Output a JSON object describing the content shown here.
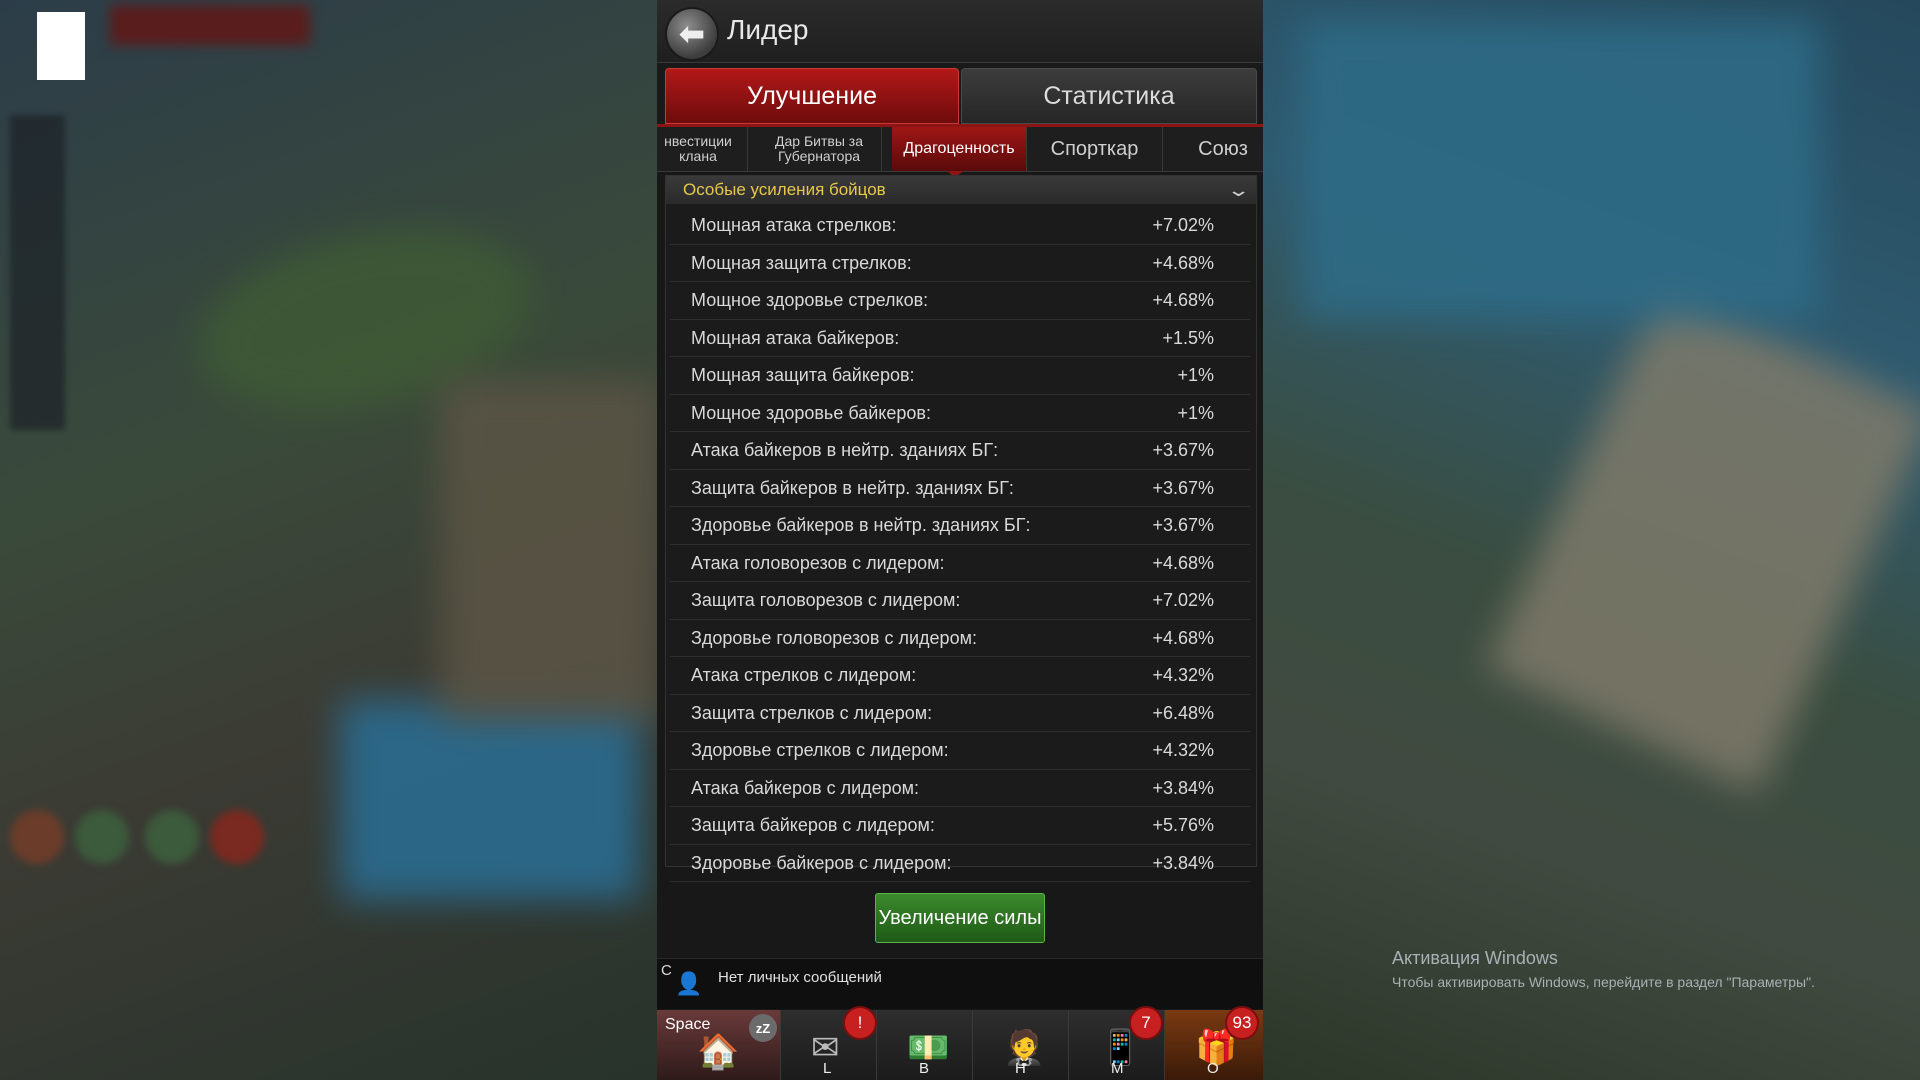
{
  "header": {
    "title": "Лидер"
  },
  "main_tabs": [
    {
      "label": "Улучшение",
      "active": true
    },
    {
      "label": "Статистика",
      "active": false
    }
  ],
  "sub_tabs": [
    {
      "label": "нвестиции клана"
    },
    {
      "label": "Дар Битвы за Губернатора"
    },
    {
      "label": "Драгоценность",
      "active": true
    },
    {
      "label": "Спорткар"
    },
    {
      "label": "Союз"
    }
  ],
  "section": {
    "title": "Особые усиления бойцов"
  },
  "stats": [
    {
      "name": "Мощная атака стрелков:",
      "value": "+7.02%"
    },
    {
      "name": "Мощная защита стрелков:",
      "value": "+4.68%"
    },
    {
      "name": "Мощное здоровье стрелков:",
      "value": "+4.68%"
    },
    {
      "name": "Мощная атака байкеров:",
      "value": "+1.5%"
    },
    {
      "name": "Мощная защита байкеров:",
      "value": "+1%"
    },
    {
      "name": "Мощное здоровье байкеров:",
      "value": "+1%"
    },
    {
      "name": "Атака байкеров в нейтр. зданиях БГ:",
      "value": "+3.67%"
    },
    {
      "name": "Защита байкеров в нейтр. зданиях БГ:",
      "value": "+3.67%"
    },
    {
      "name": "Здоровье байкеров в нейтр. зданиях БГ:",
      "value": "+3.67%"
    },
    {
      "name": "Атака головорезов с лидером:",
      "value": "+4.68%"
    },
    {
      "name": "Защита головорезов с лидером:",
      "value": "+7.02%"
    },
    {
      "name": "Здоровье головорезов с лидером:",
      "value": "+4.68%"
    },
    {
      "name": "Атака стрелков с лидером:",
      "value": "+4.32%"
    },
    {
      "name": "Защита стрелков с лидером:",
      "value": "+6.48%"
    },
    {
      "name": "Здоровье стрелков с лидером:",
      "value": "+4.32%"
    },
    {
      "name": "Атака байкеров с лидером:",
      "value": "+3.84%"
    },
    {
      "name": "Защита байкеров с лидером:",
      "value": "+5.76%"
    },
    {
      "name": "Здоровье байкеров с лидером:",
      "value": "+3.84%"
    }
  ],
  "power_button": {
    "label": "Увеличение силы"
  },
  "messages": {
    "channel": "C",
    "text": "Нет личных сообщений"
  },
  "bottom_bar": {
    "space": {
      "label": "Space",
      "sleep": "zZ"
    },
    "buttons": [
      {
        "letter": "L",
        "badge": "!",
        "icon": "mail-icon"
      },
      {
        "letter": "B",
        "icon": "cash-icon"
      },
      {
        "letter": "H",
        "icon": "hero-icon"
      },
      {
        "letter": "M",
        "badge": "7",
        "icon": "phone-icon"
      },
      {
        "letter": "O",
        "badge": "93",
        "icon": "gift-icon"
      }
    ]
  },
  "windows_activation": {
    "title": "Активация Windows",
    "text": "Чтобы активировать Windows, перейдите в раздел \"Параметры\"."
  }
}
